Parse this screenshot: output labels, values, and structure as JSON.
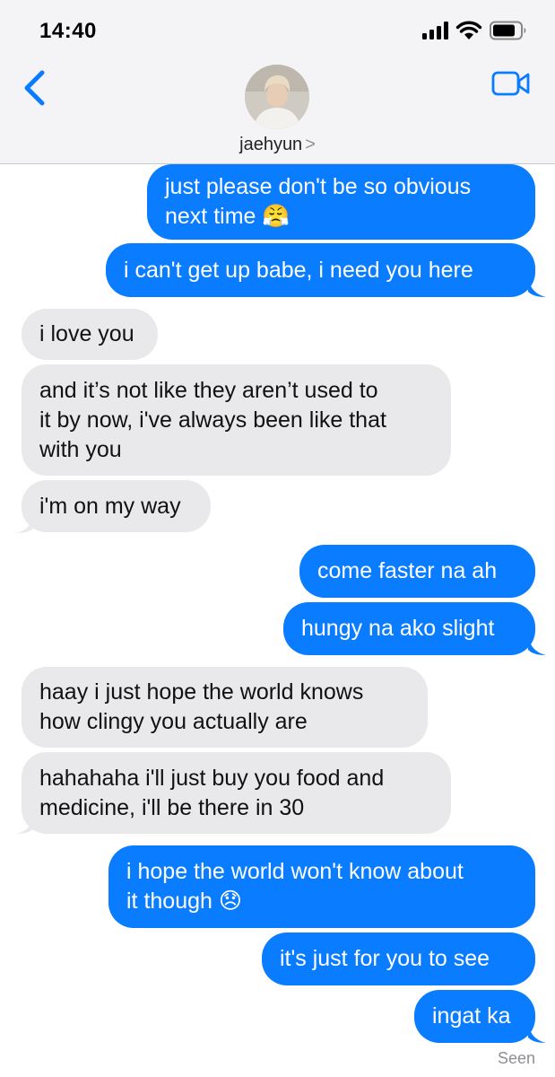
{
  "status_bar": {
    "time": "14:40"
  },
  "header": {
    "contact_name": "jaehyun",
    "chevron": ">"
  },
  "messages": [
    {
      "from": "me",
      "lines": [
        "just please don't be so obvious",
        "next time 😤"
      ]
    },
    {
      "from": "me",
      "lines": [
        "i can't get up babe, i need you here"
      ]
    },
    {
      "from": "them",
      "lines": [
        "i love you"
      ]
    },
    {
      "from": "them",
      "lines": [
        "and it’s not like they aren’t used to",
        "it by now, i've always been like that",
        "with you"
      ]
    },
    {
      "from": "them",
      "lines": [
        "i'm on my way"
      ]
    },
    {
      "from": "me",
      "lines": [
        "come faster na ah"
      ]
    },
    {
      "from": "me",
      "lines": [
        "hungy na ako slight"
      ]
    },
    {
      "from": "them",
      "lines": [
        "haay i just hope the world knows",
        "how clingy you actually are"
      ]
    },
    {
      "from": "them",
      "lines": [
        "hahahaha i'll just buy you food and",
        "medicine, i'll be there in 30"
      ]
    },
    {
      "from": "me",
      "lines": [
        "i hope the world won't know about",
        "it though 😞"
      ]
    },
    {
      "from": "me",
      "lines": [
        "it's just for you to see"
      ]
    },
    {
      "from": "me",
      "lines": [
        "ingat ka"
      ]
    }
  ],
  "receipt": "Seen",
  "colors": {
    "sent": "#0a7cff",
    "received": "#e9e9eb",
    "accent": "#0a7cff"
  },
  "icons": [
    "signal-icon",
    "wifi-icon",
    "battery-icon",
    "back-chevron-icon",
    "video-call-icon"
  ]
}
